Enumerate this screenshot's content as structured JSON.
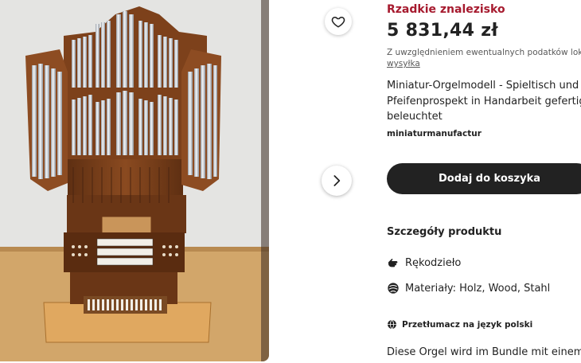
{
  "listing": {
    "rare_badge": "Rzadkie znalezisko",
    "price": "5 831,44 zł",
    "tax_note": "Z uwzględnieniem ewentualnych podatków lokal",
    "shipping_link": "wysyłka",
    "title_lines": [
      "Miniatur-Orgelmodell - Spieltisch und",
      "Pfeifenprospekt in Handarbeit gefertigt",
      "beleuchtet"
    ],
    "shop_name": "miniaturmanufactur",
    "add_to_cart": "Dodaj do koszyka",
    "details_heading": "Szczegóły produktu",
    "features": [
      {
        "icon": "hand-icon",
        "text": "Rękodzieło"
      },
      {
        "icon": "materials-icon",
        "text": "Materiały: Holz, Wood, Stahl"
      }
    ],
    "translate_link": "Przetłumacz na język polski",
    "description_start": "Diese Orgel wird im Bundle mit einem"
  },
  "gallery": {
    "favorite_icon": "heart-icon",
    "next_icon": "chevron-right-icon"
  },
  "colors": {
    "rare": "#a61a2e",
    "cart_button": "#222222",
    "wood": "#7a4420",
    "pipes": "#d9dde2"
  }
}
